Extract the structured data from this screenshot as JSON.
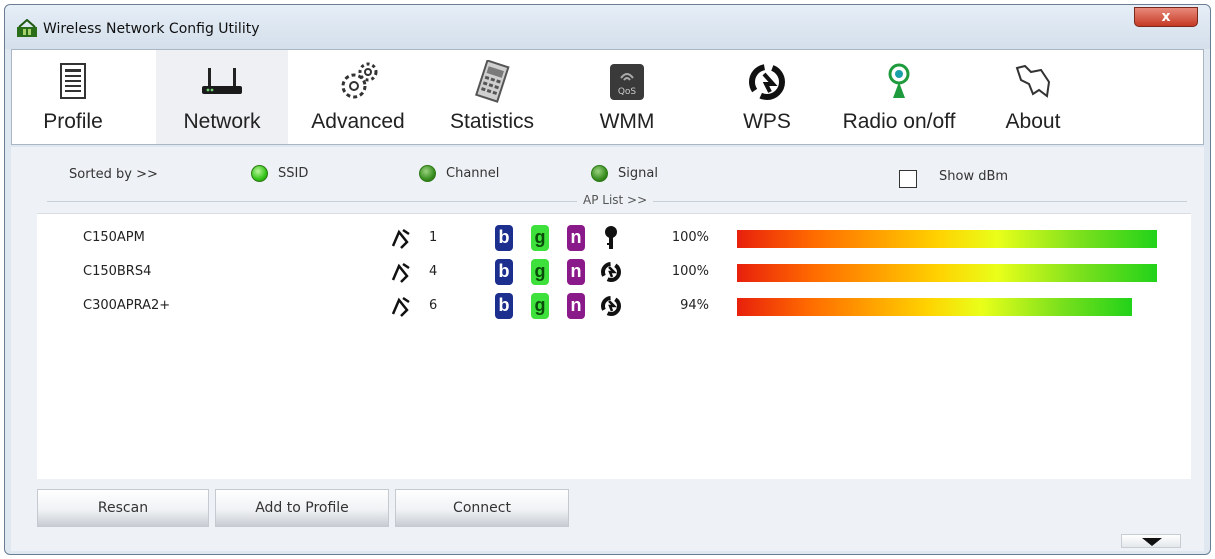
{
  "window": {
    "title": "Wireless Network Config Utility",
    "close_label": "x"
  },
  "toolbar": {
    "items": [
      {
        "label": "Profile",
        "icon": "profile-icon"
      },
      {
        "label": "Network",
        "icon": "router-icon",
        "active": true
      },
      {
        "label": "Advanced",
        "icon": "gears-icon"
      },
      {
        "label": "Statistics",
        "icon": "statistics-icon"
      },
      {
        "label": "WMM",
        "icon": "qos-icon"
      },
      {
        "label": "WPS",
        "icon": "wps-icon"
      },
      {
        "label": "Radio on/off",
        "icon": "radio-icon"
      },
      {
        "label": "About",
        "icon": "about-icon"
      }
    ]
  },
  "sort": {
    "label": "Sorted by >>",
    "options": [
      {
        "label": "SSID",
        "selected": true
      },
      {
        "label": "Channel",
        "selected": false
      },
      {
        "label": "Signal",
        "selected": false
      }
    ],
    "show_dbm_label": "Show dBm",
    "show_dbm_checked": false
  },
  "ap_list": {
    "label": "AP List >>",
    "rows": [
      {
        "ssid": "C150APM",
        "channel": "1",
        "modes": [
          "b",
          "g",
          "n"
        ],
        "security": "key-icon",
        "signal_label": "100%",
        "signal": 100
      },
      {
        "ssid": "C150BRS4",
        "channel": "4",
        "modes": [
          "b",
          "g",
          "n"
        ],
        "security": "wps-icon",
        "signal_label": "100%",
        "signal": 100
      },
      {
        "ssid": "C300APRA2+",
        "channel": "6",
        "modes": [
          "b",
          "g",
          "n"
        ],
        "security": "wps-icon",
        "signal_label": "94%",
        "signal": 94
      }
    ]
  },
  "buttons": {
    "rescan": "Rescan",
    "add_to_profile": "Add to Profile",
    "connect": "Connect"
  }
}
